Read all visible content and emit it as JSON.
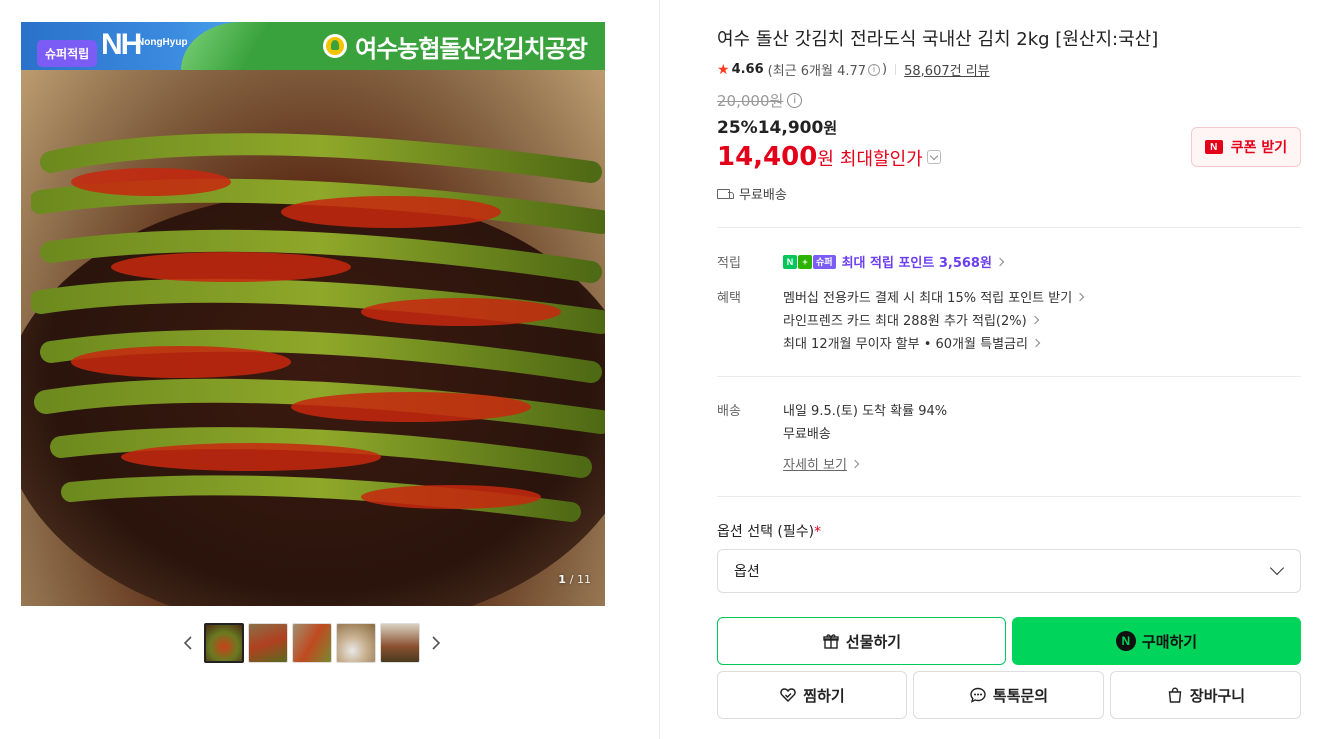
{
  "gallery": {
    "banner_logo": "NH",
    "banner_logo_sub": "NongHyup",
    "banner_title": "여수농협돌산갓김치공장",
    "super_badge": "슈퍼적립",
    "counter_current": "1",
    "counter_total": "/ 11",
    "thumbnail_count": 5,
    "active_thumbnail": 0
  },
  "product": {
    "title": "여수 돌산 갓김치 전라도식 국내산 김치 2kg [원산지:국산]",
    "rating": "4.66",
    "rating_recent": "(최근 6개월 4.77",
    "rating_recent_close": ")",
    "review_count": "58,607건 리뷰",
    "original_price": "20,000원",
    "discount_rate": "25%",
    "sale_price": "14,900",
    "sale_won": "원",
    "max_price": "14,400",
    "max_won": "원",
    "max_label": "최대할인가",
    "coupon_label": "쿠폰 받기",
    "coupon_badge": "N",
    "shipping": "무료배송"
  },
  "benefits": {
    "point_label": "적립",
    "point_badges": [
      "N",
      "+",
      "슈퍼"
    ],
    "point_text": "최대 적립 포인트 3,568원",
    "benefit_label": "혜택",
    "benefit_lines": [
      "멤버십 전용카드 결제 시 최대 15% 적립 포인트 받기",
      "라인프렌즈 카드 최대 288원 추가 적립(2%)",
      "최대 12개월 무이자 할부 • 60개월 특별금리"
    ]
  },
  "delivery": {
    "label": "배송",
    "line1": "내일 9.5.(토) 도착 확률 94%",
    "line2": "무료배송",
    "more": "자세히 보기"
  },
  "options": {
    "label": "옵션 선택 (필수)",
    "required_mark": "*",
    "selected": "옵션"
  },
  "actions": {
    "gift": "선물하기",
    "buy": "구매하기",
    "wish": "찜하기",
    "talk": "톡톡문의",
    "cart": "장바구니"
  },
  "colors": {
    "sale_red": "#e5001a",
    "naver_green": "#00d45a",
    "point_purple": "#6b3ff0"
  }
}
